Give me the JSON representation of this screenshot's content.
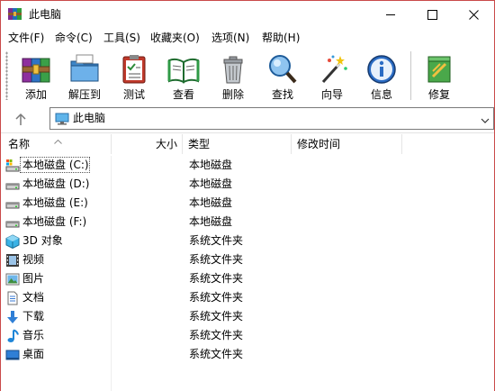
{
  "window": {
    "title": "此电脑",
    "accent_border": "#c94a4a"
  },
  "menu": {
    "items": [
      {
        "label": "文件(F)",
        "name": "menu-file"
      },
      {
        "label": "命令(C)",
        "name": "menu-command"
      },
      {
        "label": "工具(S)",
        "name": "menu-tools"
      },
      {
        "label": "收藏夹(O)",
        "name": "menu-favorites"
      },
      {
        "label": "选项(N)",
        "name": "menu-options"
      },
      {
        "label": "帮助(H)",
        "name": "menu-help"
      }
    ]
  },
  "toolbar": {
    "add": "添加",
    "extract": "解压到",
    "test": "测试",
    "view": "查看",
    "delete": "删除",
    "find": "查找",
    "wizard": "向导",
    "info": "信息",
    "repair": "修复"
  },
  "address": {
    "path": "此电脑"
  },
  "columns": {
    "name": "名称",
    "size": "大小",
    "type": "类型",
    "modified": "修改时间"
  },
  "rows": [
    {
      "name": "本地磁盘 (C:)",
      "type": "本地磁盘",
      "icon": "system-drive-icon",
      "selected": true
    },
    {
      "name": "本地磁盘 (D:)",
      "type": "本地磁盘",
      "icon": "drive-icon"
    },
    {
      "name": "本地磁盘 (E:)",
      "type": "本地磁盘",
      "icon": "drive-icon"
    },
    {
      "name": "本地磁盘 (F:)",
      "type": "本地磁盘",
      "icon": "drive-icon"
    },
    {
      "name": "3D 对象",
      "type": "系统文件夹",
      "icon": "3d-objects-icon"
    },
    {
      "name": "视频",
      "type": "系统文件夹",
      "icon": "videos-icon"
    },
    {
      "name": "图片",
      "type": "系统文件夹",
      "icon": "pictures-icon"
    },
    {
      "name": "文档",
      "type": "系统文件夹",
      "icon": "documents-icon"
    },
    {
      "name": "下载",
      "type": "系统文件夹",
      "icon": "downloads-icon"
    },
    {
      "name": "音乐",
      "type": "系统文件夹",
      "icon": "music-icon"
    },
    {
      "name": "桌面",
      "type": "系统文件夹",
      "icon": "desktop-icon"
    }
  ]
}
